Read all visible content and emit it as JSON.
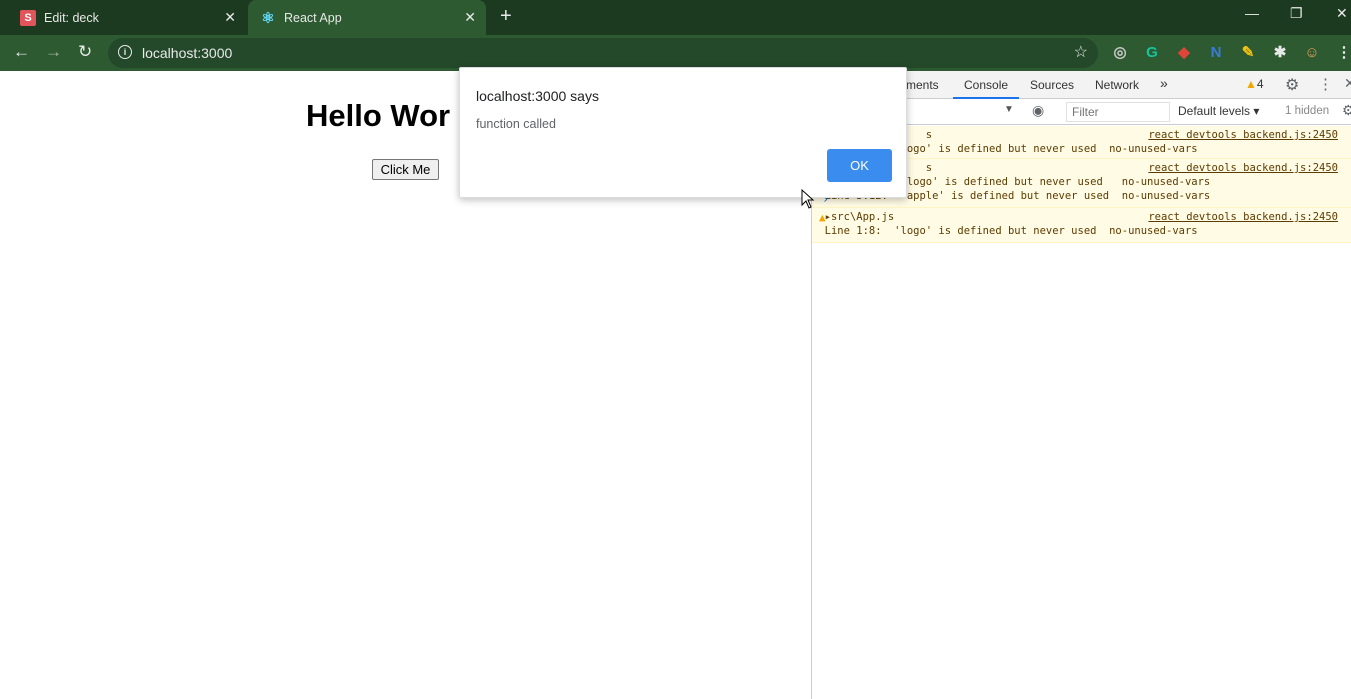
{
  "browser": {
    "tabs": [
      {
        "favicon": "S",
        "title": "Edit: deck",
        "close": "✕"
      },
      {
        "favicon": "⚛",
        "title": "React App",
        "close": "✕"
      }
    ],
    "new_tab": "+",
    "window_controls": {
      "minimize": "—",
      "restore": "❐",
      "close": "✕"
    },
    "nav": {
      "back": "←",
      "forward": "→",
      "reload": "↻"
    },
    "omnibox": {
      "info": "i",
      "url": "localhost:3000",
      "star": "☆"
    },
    "extensions": [
      {
        "name": "circle-extension-icon",
        "glyph": "◎",
        "color": "#c8c8c8"
      },
      {
        "name": "grammarly-extension-icon",
        "glyph": "G",
        "color": "#15c39a"
      },
      {
        "name": "red-extension-icon",
        "glyph": "◆",
        "color": "#e0453a"
      },
      {
        "name": "n-extension-icon",
        "glyph": "N",
        "color": "#3a7bd5"
      },
      {
        "name": "pencil-extension-icon",
        "glyph": "✎",
        "color": "#f4c20d"
      },
      {
        "name": "puzzle-extensions-icon",
        "glyph": "✱",
        "color": "#e8eae8"
      },
      {
        "name": "profile-avatar-icon",
        "glyph": "☺",
        "color": "#e8a05a"
      },
      {
        "name": "browser-menu-icon",
        "glyph": "⋮",
        "color": "#e8eae8"
      }
    ]
  },
  "page": {
    "heading": "Hello Wor",
    "button_label": "Click Me"
  },
  "devtools": {
    "tabs": {
      "elements_partial": "ments",
      "console": "Console",
      "sources": "Sources",
      "network": "Network",
      "more": "»"
    },
    "warnings_count": "4",
    "filter_placeholder": "Filter",
    "default_levels": "Default levels ▾",
    "hidden": "1 hidden",
    "messages": [
      {
        "lines": [
          "                  s",
          "  Line 1:8:  'logo' is defined but never used  no-unused-vars"
        ],
        "source": "react devtools backend.js:2450"
      },
      {
        "lines": [
          "                  s",
          "  Line 1:8:   'logo' is defined but never used   no-unused-vars",
          "  Line 3:12:  'apple' is defined but never used  no-unused-vars"
        ],
        "source": "react devtools backend.js:2450"
      },
      {
        "lines": [
          "  ▸src\\App.js",
          "  Line 1:8:  'logo' is defined but never used  no-unused-vars"
        ],
        "source": "react devtools backend.js:2450"
      }
    ],
    "prompt": "›"
  },
  "alert": {
    "title": "localhost:3000 says",
    "message": "function called",
    "ok": "OK"
  }
}
